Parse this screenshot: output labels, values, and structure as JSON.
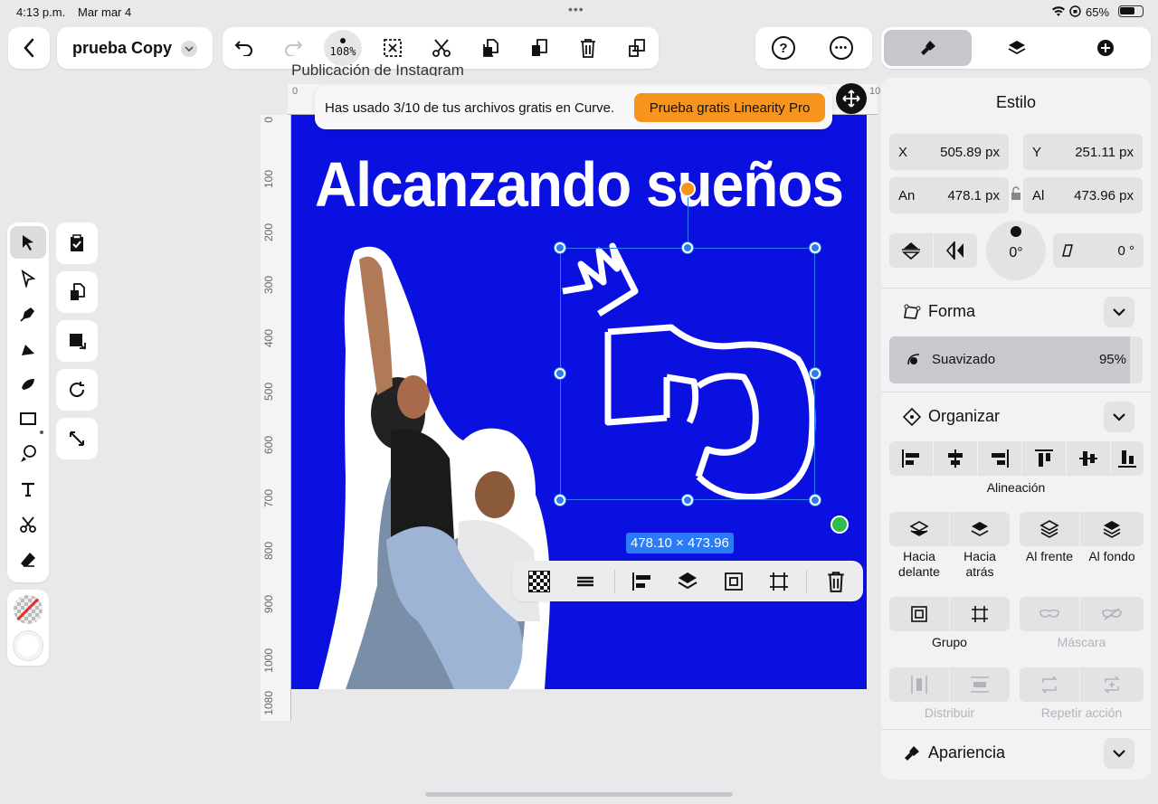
{
  "status_bar": {
    "time": "4:13 p.m.",
    "date": "Mar mar 4",
    "battery": "65%"
  },
  "toolbar": {
    "doc_name": "prueba Copy",
    "zoom": "108%"
  },
  "canvas": {
    "artboard_label": "Publicación de Instagram",
    "ruler_h_zero": "0",
    "ruler_h_end": "10",
    "ruler_v": [
      "0",
      "100",
      "200",
      "300",
      "400",
      "500",
      "600",
      "700",
      "800",
      "900",
      "1000",
      "1080"
    ],
    "headline": "Alcanzando sueños",
    "selection_size": "478.10 × 473.96",
    "colors": {
      "artboard": "#0a10e0",
      "selection": "#2a7cf6",
      "accent": "#f7941d"
    }
  },
  "banner": {
    "message": "Has usado 3/10 de tus archivos gratis en Curve.",
    "cta": "Prueba gratis Linearity Pro"
  },
  "panel": {
    "title": "Estilo",
    "x_label": "X",
    "x_value": "505.89 px",
    "y_label": "Y",
    "y_value": "251.11 px",
    "w_label": "An",
    "w_value": "478.1 px",
    "h_label": "Al",
    "h_value": "473.96 px",
    "rotation": "0°",
    "skew": "0 °",
    "forma": {
      "title": "Forma",
      "smooth_label": "Suavizado",
      "smooth_value": "95%",
      "smooth_fraction": 0.95
    },
    "organizar": {
      "title": "Organizar",
      "align_label": "Alineación",
      "forward": "Hacia delante",
      "backward": "Hacia atrás",
      "front": "Al frente",
      "back": "Al fondo",
      "group": "Grupo",
      "mask": "Máscara",
      "distribute": "Distribuir",
      "repeat": "Repetir acción"
    },
    "apariencia": {
      "title": "Apariencia"
    }
  }
}
